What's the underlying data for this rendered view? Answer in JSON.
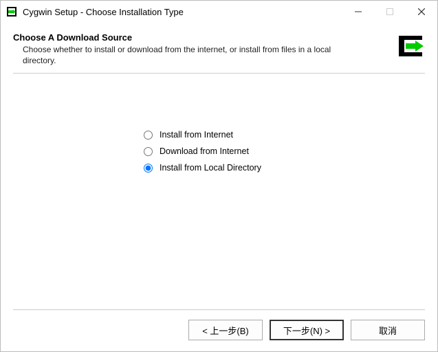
{
  "window": {
    "title": "Cygwin Setup - Choose Installation Type"
  },
  "header": {
    "title": "Choose A Download Source",
    "description": "Choose whether to install or download from the internet, or install from files in a local directory."
  },
  "options": {
    "items": [
      {
        "label": "Install from Internet",
        "selected": false
      },
      {
        "label": "Download from Internet",
        "selected": false
      },
      {
        "label": "Install from Local Directory",
        "selected": true
      }
    ]
  },
  "buttons": {
    "back": "< 上一步(B)",
    "next": "下一步(N) >",
    "cancel": "取消"
  }
}
